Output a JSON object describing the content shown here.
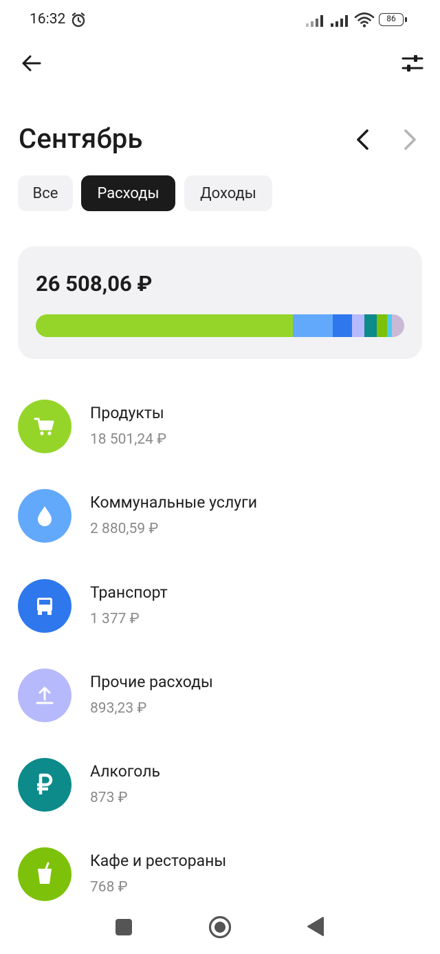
{
  "status_bar": {
    "time": "16:32",
    "battery": "86",
    "icons": [
      "alarm-icon",
      "signal-icon",
      "signal-icon",
      "wifi-icon",
      "battery-icon"
    ]
  },
  "header": {
    "back_icon": "arrow-left-icon",
    "filter_icon": "sliders-icon"
  },
  "month": {
    "title": "Сентябрь",
    "prev_icon": "chevron-left-icon",
    "next_icon": "chevron-right-icon"
  },
  "tabs": [
    {
      "label": "Все",
      "active": false
    },
    {
      "label": "Расходы",
      "active": true
    },
    {
      "label": "Доходы",
      "active": false
    }
  ],
  "summary": {
    "total": "26 508,06 ₽",
    "breakdown": [
      {
        "category": "Продукты",
        "value": 18501.24,
        "color": "#95d52a"
      },
      {
        "category": "Коммунальные услуги",
        "value": 2880.59,
        "color": "#63a9fb"
      },
      {
        "category": "Транспорт",
        "value": 1377,
        "color": "#2f77ec"
      },
      {
        "category": "Прочие расходы",
        "value": 893.23,
        "color": "#b6b9fb"
      },
      {
        "category": "Алкоголь",
        "value": 873,
        "color": "#0d8a8a"
      },
      {
        "category": "Кафе и рестораны",
        "value": 768,
        "color": "#7ec10a"
      },
      {
        "category": "other-1",
        "value": 330,
        "color": "#4fcbf0"
      },
      {
        "category": "other-2",
        "value": 885,
        "color": "#c9b9d6"
      }
    ]
  },
  "categories": [
    {
      "name": "Продукты",
      "amount": "18 501,24 ₽",
      "icon": "cart-icon",
      "color": "#95d52a"
    },
    {
      "name": "Коммунальные услуги",
      "amount": "2 880,59 ₽",
      "icon": "drop-icon",
      "color": "#63a9fb"
    },
    {
      "name": "Транспорт",
      "amount": "1 377 ₽",
      "icon": "truck-icon",
      "color": "#2f77ec"
    },
    {
      "name": "Прочие расходы",
      "amount": "893,23 ₽",
      "icon": "upload-icon",
      "color": "#b6b9fb"
    },
    {
      "name": "Алкоголь",
      "amount": "873 ₽",
      "icon": "ruble-icon",
      "color": "#0d8a8a"
    },
    {
      "name": "Кафе и рестораны",
      "amount": "768 ₽",
      "icon": "cup-icon",
      "color": "#7ec10a"
    }
  ],
  "nav_bar": {
    "icons": [
      "recents-icon",
      "home-icon",
      "back-icon"
    ]
  }
}
